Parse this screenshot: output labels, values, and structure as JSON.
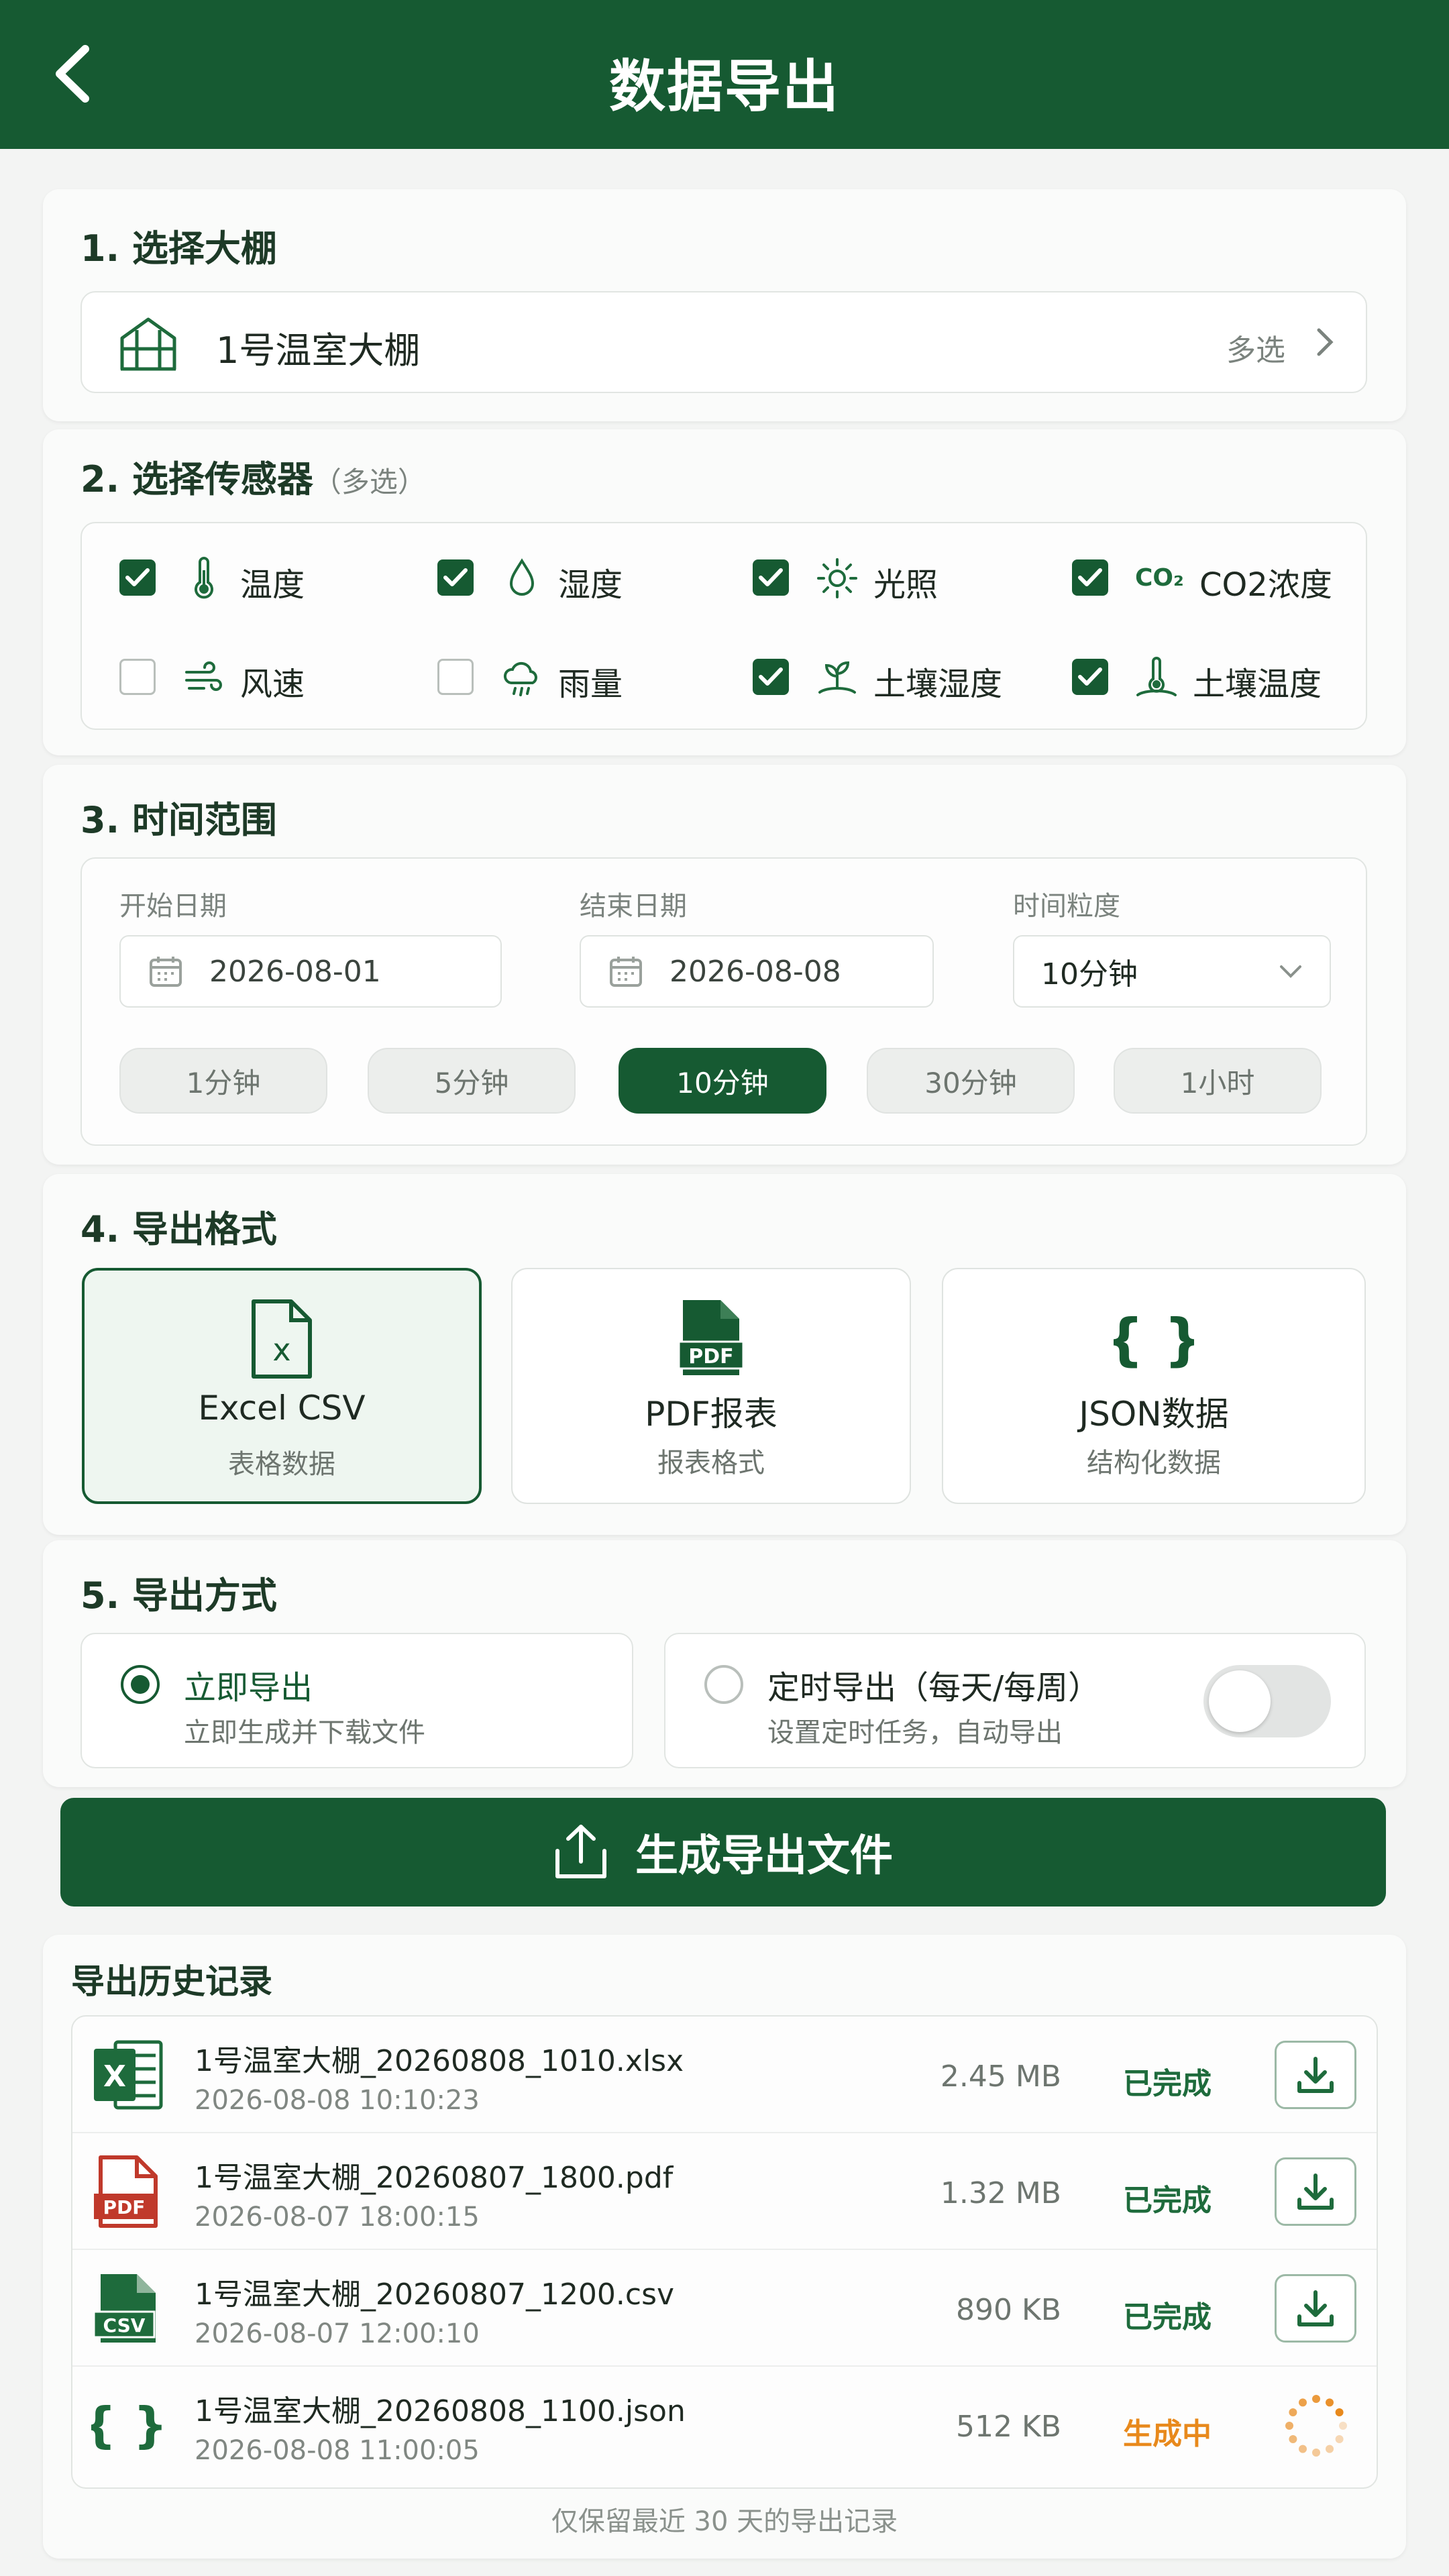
{
  "header": {
    "title": "数据导出",
    "back_icon": "back-arrow-icon"
  },
  "section1": {
    "title": "1. 选择大棚",
    "greenhouse": "1号温室大棚",
    "multi_label": "多选"
  },
  "section2": {
    "title": "2. 选择传感器",
    "subtitle": "（多选）",
    "sensors": [
      {
        "label": "温度",
        "checked": true,
        "icon": "thermometer-icon"
      },
      {
        "label": "湿度",
        "checked": true,
        "icon": "water-drop-icon"
      },
      {
        "label": "光照",
        "checked": true,
        "icon": "sun-icon"
      },
      {
        "label": "CO2浓度",
        "checked": true,
        "icon": "co2-icon",
        "icon_text": "CO₂"
      },
      {
        "label": "风速",
        "checked": false,
        "icon": "wind-icon"
      },
      {
        "label": "雨量",
        "checked": false,
        "icon": "rain-cloud-icon"
      },
      {
        "label": "土壤湿度",
        "checked": true,
        "icon": "soil-plant-icon"
      },
      {
        "label": "土壤温度",
        "checked": true,
        "icon": "soil-thermometer-icon"
      }
    ]
  },
  "section3": {
    "title": "3. 时间范围",
    "start_label": "开始日期",
    "start_value": "2026-08-01",
    "end_label": "结束日期",
    "end_value": "2026-08-08",
    "granularity_label": "时间粒度",
    "granularity_value": "10分钟",
    "chips": [
      "1分钟",
      "5分钟",
      "10分钟",
      "30分钟",
      "1小时"
    ],
    "active_chip": 2
  },
  "section4": {
    "title": "4. 导出格式",
    "formats": [
      {
        "name": "Excel CSV",
        "desc": "表格数据",
        "icon": "excel-file-icon",
        "icon_text": "x"
      },
      {
        "name": "PDF报表",
        "desc": "报表格式",
        "icon": "pdf-file-icon",
        "icon_text": "PDF"
      },
      {
        "name": "JSON数据",
        "desc": "结构化数据",
        "icon": "json-braces-icon",
        "icon_text": "{ }"
      }
    ],
    "selected": 0
  },
  "section5": {
    "title": "5. 导出方式",
    "now_title": "立即导出",
    "now_desc": "立即生成并下载文件",
    "sched_title": "定时导出（每天/每周）",
    "sched_desc": "设置定时任务，自动导出",
    "selected": "now",
    "schedule_enabled": false
  },
  "generate_button": {
    "label": "生成导出文件",
    "icon": "upload-icon"
  },
  "history": {
    "title": "导出历史记录",
    "footer": "仅保留最近 30 天的导出记录",
    "rows": [
      {
        "name": "1号温室大棚_20260808_1010.xlsx",
        "time": "2026-08-08 10:10:23",
        "size": "2.45 MB",
        "status": "已完成",
        "icon": "excel-file-icon",
        "icon_text": "X",
        "done": true
      },
      {
        "name": "1号温室大棚_20260807_1800.pdf",
        "time": "2026-08-07 18:00:15",
        "size": "1.32 MB",
        "status": "已完成",
        "icon": "pdf-file-icon",
        "icon_text": "PDF",
        "done": true
      },
      {
        "name": "1号温室大棚_20260807_1200.csv",
        "time": "2026-08-07 12:00:10",
        "size": "890 KB",
        "status": "已完成",
        "icon": "csv-file-icon",
        "icon_text": "CSV",
        "done": true
      },
      {
        "name": "1号温室大棚_20260808_1100.json",
        "time": "2026-08-08 11:00:05",
        "size": "512 KB",
        "status": "生成中",
        "icon": "json-braces-icon",
        "icon_text": "{ }",
        "done": false
      }
    ]
  },
  "colors": {
    "primary": "#165a32",
    "status_done": "#1e6b3c",
    "status_pending": "#e8891c",
    "pdf_red": "#c0392b"
  }
}
